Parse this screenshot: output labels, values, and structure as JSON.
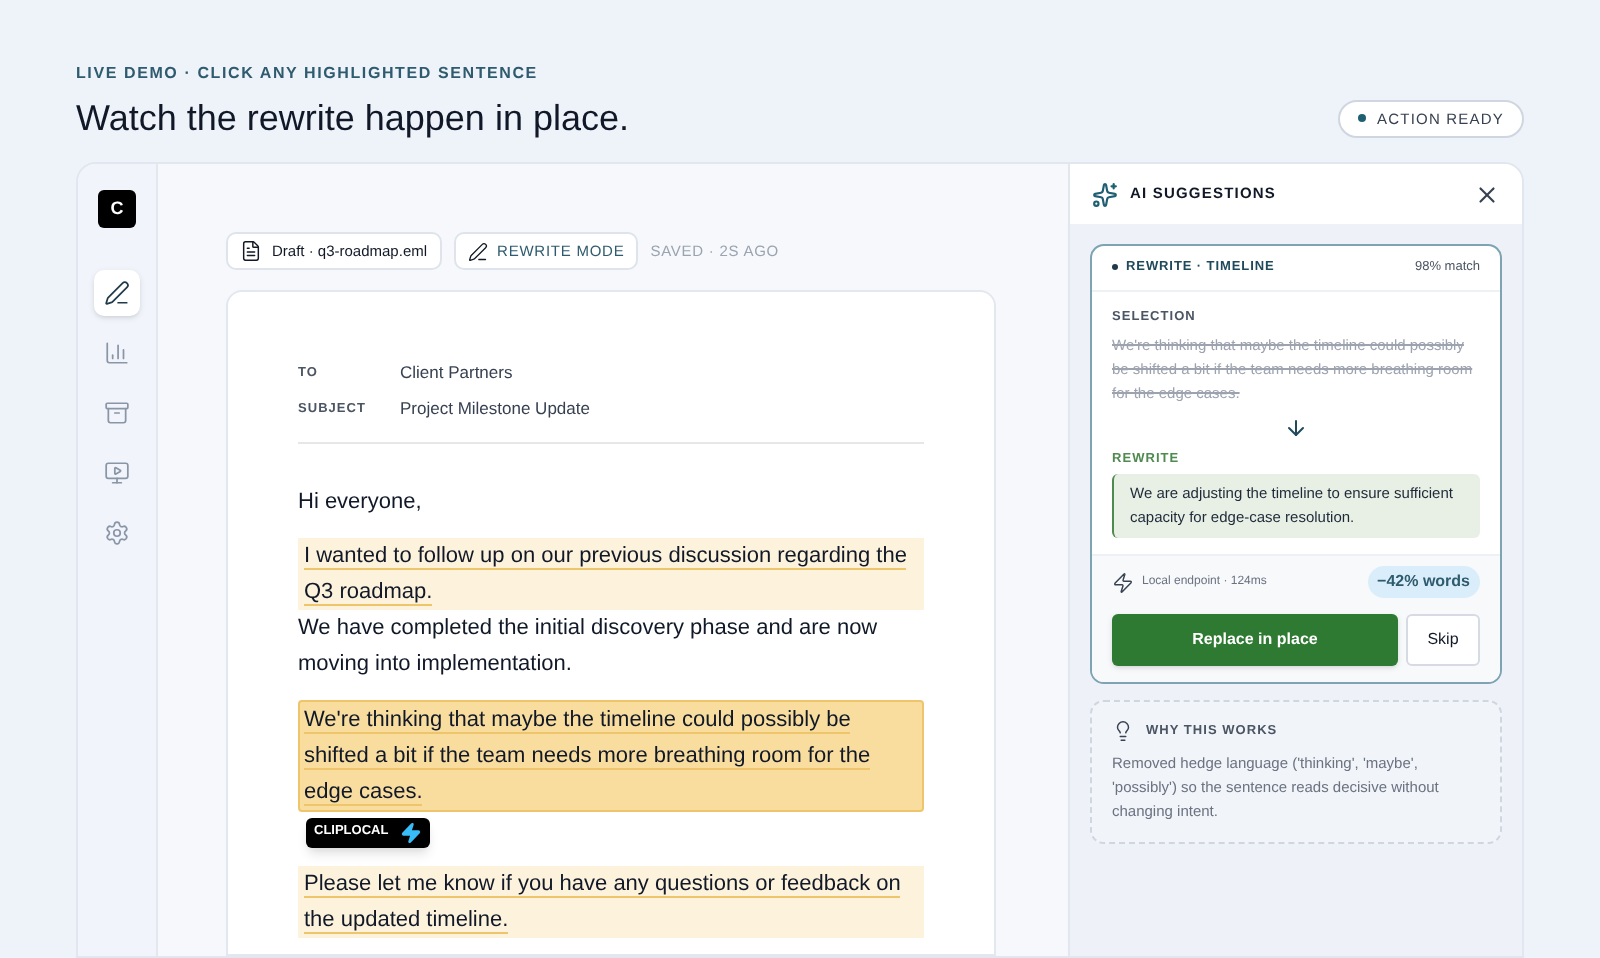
{
  "header": {
    "eyebrow": "LIVE DEMO · CLICK ANY HIGHLIGHTED SENTENCE",
    "title": "Watch the rewrite happen in place.",
    "status": {
      "label": "ACTION READY",
      "on": true
    }
  },
  "app": {
    "logo": "C",
    "rail": [
      {
        "kind": "edit",
        "selected": true
      },
      {
        "kind": "chart",
        "selected": false
      },
      {
        "kind": "archive",
        "selected": false
      },
      {
        "kind": "media",
        "selected": false
      },
      {
        "kind": "settings",
        "selected": false
      }
    ],
    "toolbar": {
      "file": "Draft · q3-roadmap.eml",
      "mode": "REWRITE MODE",
      "saved": "SAVED · 2S AGO"
    },
    "email": {
      "fields": [
        {
          "label": "TO",
          "value": "Client Partners"
        },
        {
          "label": "SUBJECT",
          "value": "Project Milestone Update"
        }
      ],
      "paragraphs": [
        {
          "sentences": [
            {
              "text": "Hi everyone,",
              "highlighted": false,
              "selected": false
            }
          ]
        },
        {
          "sentences": [
            {
              "text": "I wanted to follow up on our previous discussion regarding the Q3 roadmap.",
              "highlighted": true,
              "selected": false
            },
            {
              "text": "We have completed the initial discovery phase and are now moving into implementation.",
              "highlighted": false,
              "selected": false
            }
          ]
        },
        {
          "sentences": [
            {
              "text": "We're thinking that maybe the timeline could possibly be shifted a bit if the team needs more breathing room for the edge cases.",
              "highlighted": true,
              "selected": true
            }
          ]
        },
        {
          "sentences": [
            {
              "text": "Please let me know if you have any questions or feedback on the updated timeline.",
              "highlighted": true,
              "selected": false
            }
          ]
        }
      ],
      "tag": "CLIPLOCAL"
    },
    "panel": {
      "title": "AI SUGGESTIONS",
      "suggestion": {
        "label": "REWRITE · TIMELINE",
        "match": "98% match",
        "selection_label": "SELECTION",
        "selection": "We're thinking that maybe the timeline could possibly be shifted a bit if the team needs more breathing room for the edge cases.",
        "rewrite_label": "REWRITE",
        "rewrite": "We are adjusting the timeline to ensure sufficient capacity for edge-case resolution.",
        "endpoint": "Local endpoint · 124ms",
        "delta": "−42% words",
        "primary": "Replace in place",
        "secondary": "Skip"
      },
      "why": {
        "title": "WHY THIS WORKS",
        "text": "Removed hedge language ('thinking', 'maybe', 'possibly') so the sentence reads decisive without changing intent."
      }
    }
  }
}
